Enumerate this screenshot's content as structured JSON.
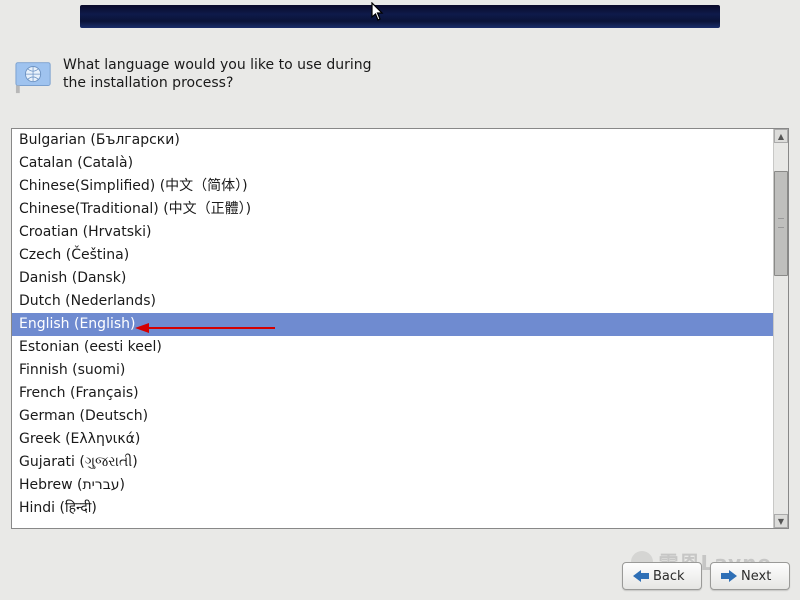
{
  "prompt": "What language would you like to use during the installation process?",
  "languages": [
    "Bulgarian (Български)",
    "Catalan (Català)",
    "Chinese(Simplified) (中文（简体）)",
    "Chinese(Traditional) (中文（正體）)",
    "Croatian (Hrvatski)",
    "Czech (Čeština)",
    "Danish (Dansk)",
    "Dutch (Nederlands)",
    "English (English)",
    "Estonian (eesti keel)",
    "Finnish (suomi)",
    "French (Français)",
    "German (Deutsch)",
    "Greek (Ελληνικά)",
    "Gujarati (ગુજરાતી)",
    "Hebrew (עברית)",
    "Hindi (हिन्दी)"
  ],
  "selected_index": 8,
  "buttons": {
    "back": "Back",
    "next": "Next"
  },
  "watermark": "雷恩Layne"
}
